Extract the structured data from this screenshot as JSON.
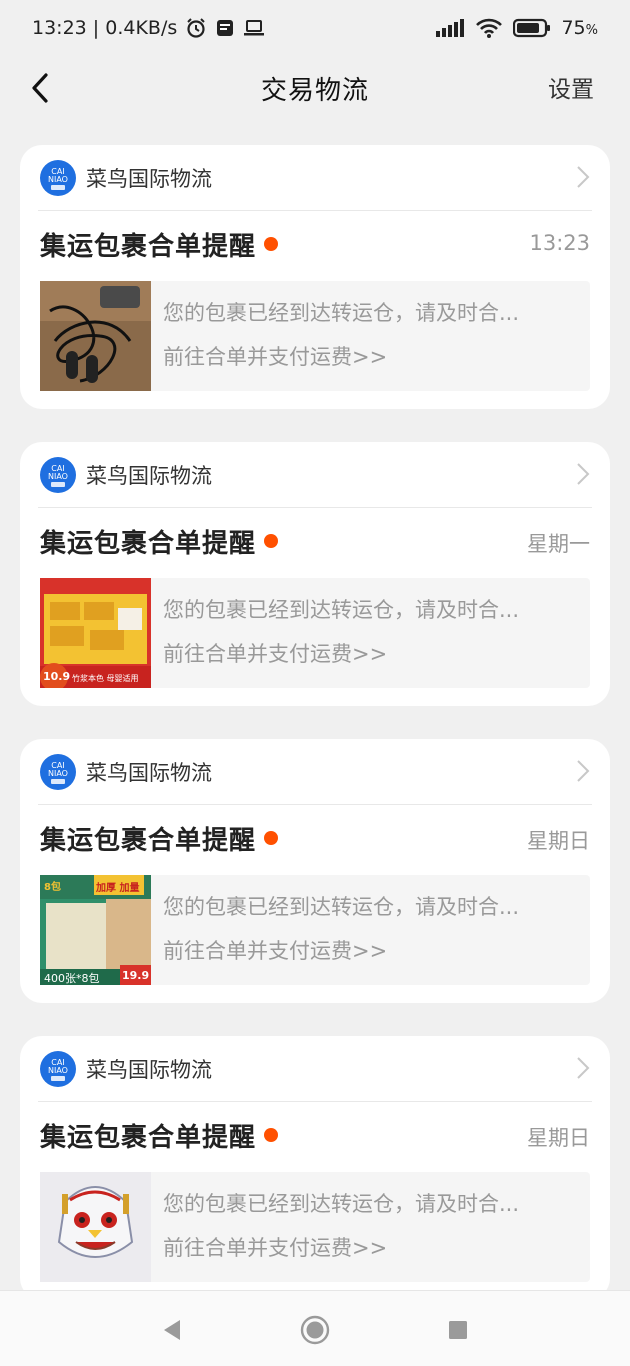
{
  "status_bar": {
    "time_speed": "13:23 | 0.4KB/s",
    "battery": "75",
    "battery_unit": "%"
  },
  "header": {
    "title": "交易物流",
    "settings_label": "设置"
  },
  "messages": [
    {
      "source": "菜鸟国际物流",
      "title": "集运包裹合单提醒",
      "time": "13:23",
      "line1": "您的包裹已经到达转运仓，请及时合...",
      "line2": "前往合单并支付运费>>",
      "thumb": "earphones"
    },
    {
      "source": "菜鸟国际物流",
      "title": "集运包裹合单提醒",
      "time": "星期一",
      "line1": "您的包裹已经到达转运仓，请及时合...",
      "line2": "前往合单并支付运费>>",
      "thumb": "tissue-boxes",
      "thumb_price": "10.9",
      "thumb_caption": "竹浆本色 母婴适用"
    },
    {
      "source": "菜鸟国际物流",
      "title": "集运包裹合单提醒",
      "time": "星期日",
      "line1": "您的包裹已经到达转运仓，请及时合...",
      "line2": "前往合单并支付运费>>",
      "thumb": "tissue-pack",
      "thumb_top": "8包",
      "thumb_tag": "加厚 加量",
      "thumb_count": "400张*8包",
      "thumb_price": "19.9"
    },
    {
      "source": "菜鸟国际物流",
      "title": "集运包裹合单提醒",
      "time": "星期日",
      "line1": "您的包裹已经到达转运仓，请及时合...",
      "line2": "前往合单并支付运费>>",
      "thumb": "lion-mask"
    }
  ],
  "colors": {
    "accent_dot": "#ff5000",
    "logo_blue": "#1f6fe0"
  }
}
